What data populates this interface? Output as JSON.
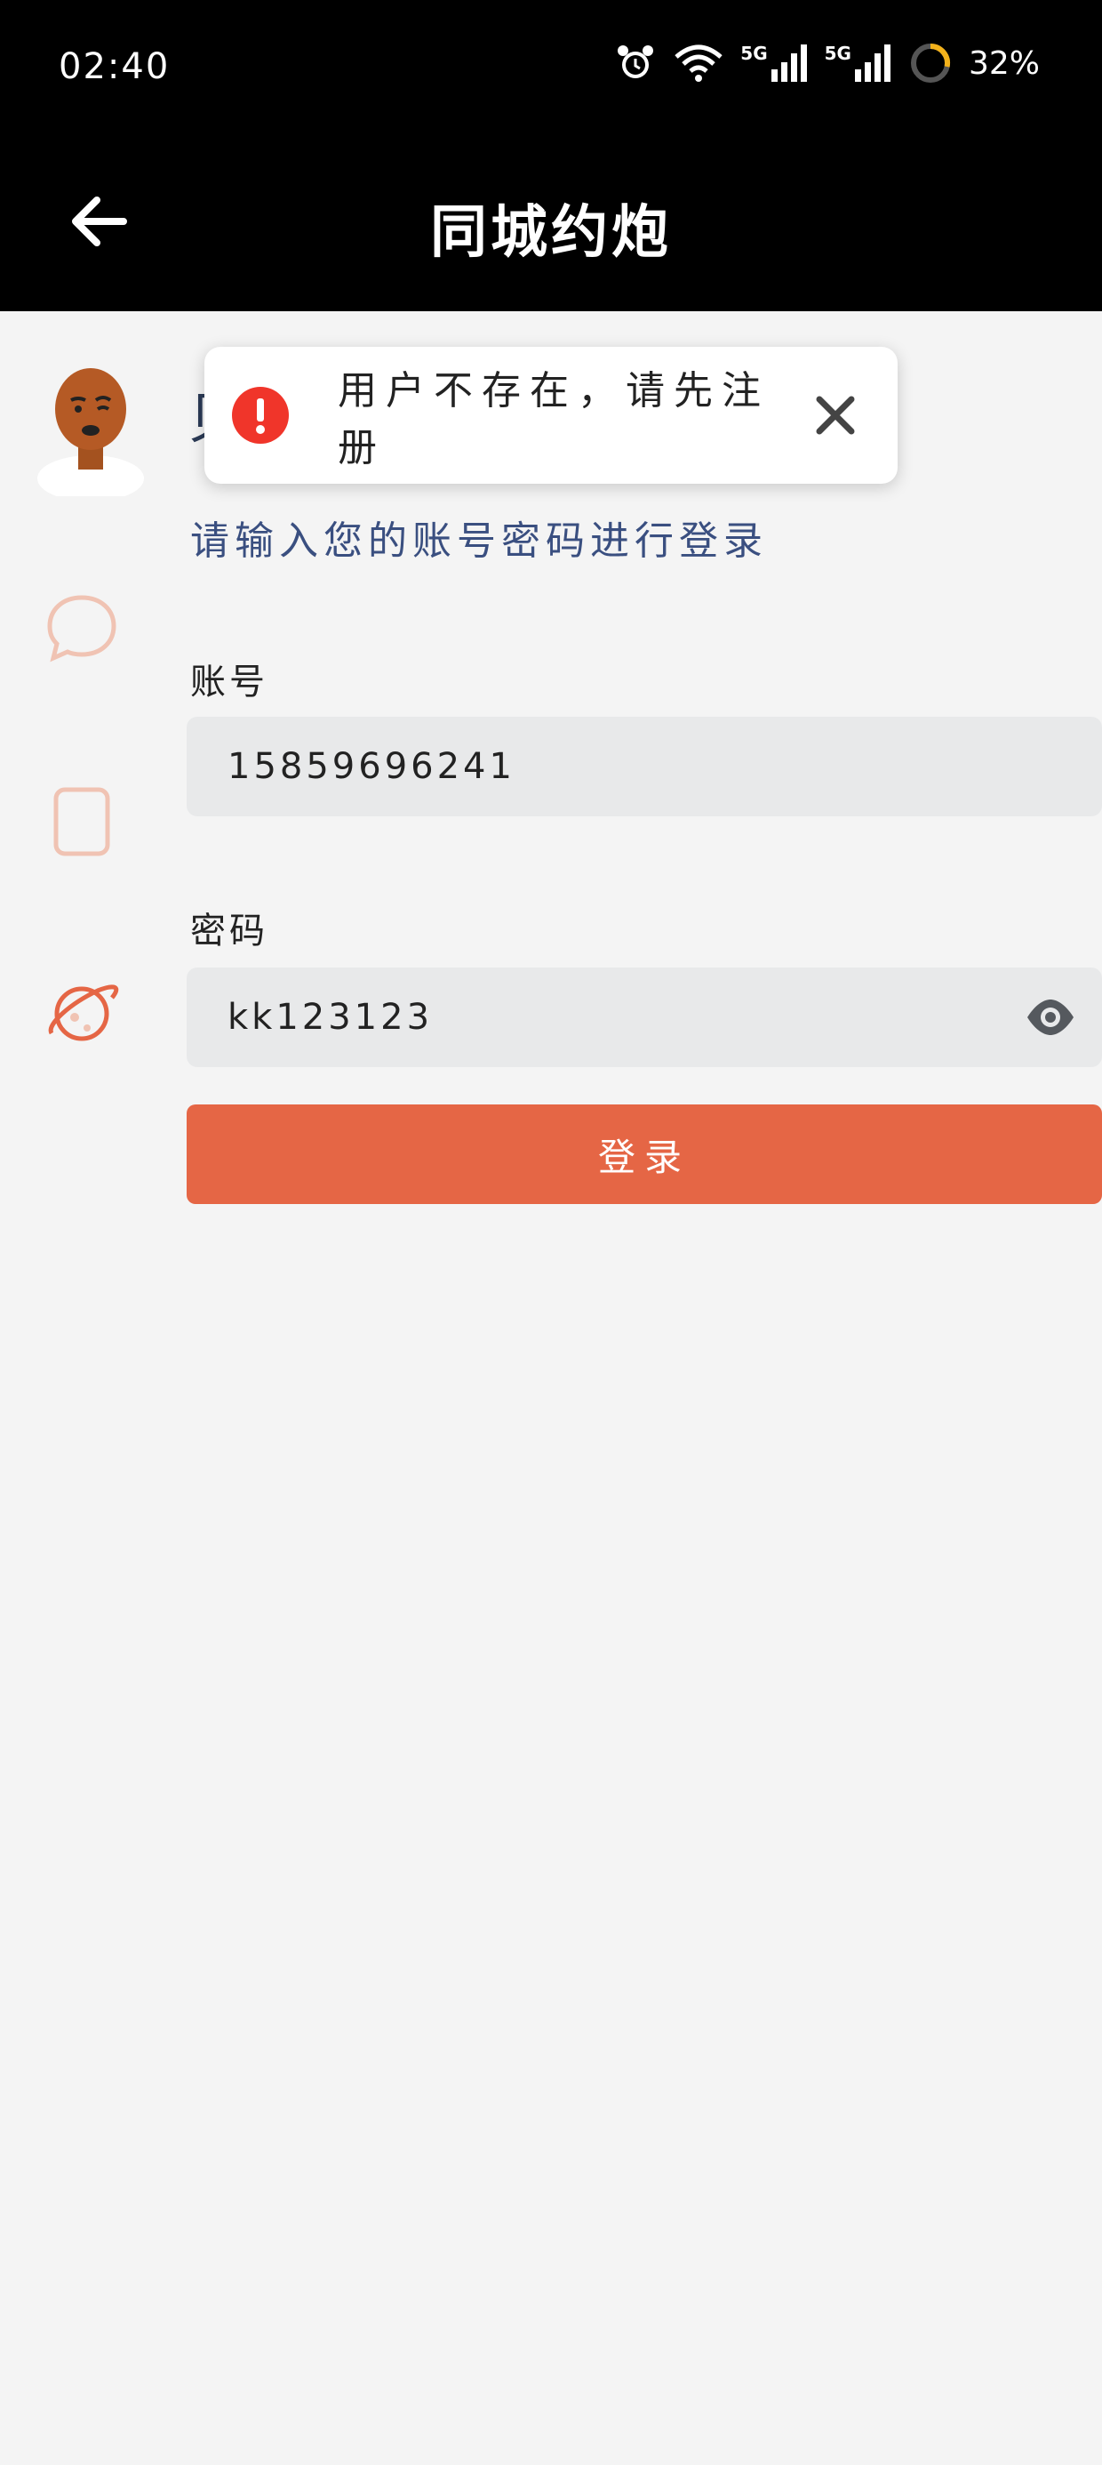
{
  "status_bar": {
    "time": "02:40",
    "battery_percent": "32%",
    "network_label_1": "5G",
    "network_label_2": "5G",
    "icons": [
      "alarm-icon",
      "wifi-icon",
      "signal-5g-icon",
      "signal-5g-icon",
      "battery-ring-icon"
    ]
  },
  "app_bar": {
    "title": "同城约炮",
    "back_icon": "arrow-left-icon"
  },
  "sidebar": {
    "avatar": "avatar-illustration",
    "icons": [
      "chat-bubble-icon",
      "phone-outline-icon",
      "planet-icon"
    ]
  },
  "login": {
    "heading_partial": "贝",
    "subtitle": "请输入您的账号密码进行登录",
    "account_label": "账号",
    "account_value": "15859696241",
    "password_label": "密码",
    "password_value": "kk123123",
    "login_button": "登录"
  },
  "toast": {
    "message": "用户不存在，请先注册",
    "icon": "error-icon",
    "close_icon": "close-icon"
  },
  "colors": {
    "accent": "#e56645",
    "toast_error": "#f0352a",
    "subtitle": "#3a4f80",
    "field_bg": "#e8e9ea",
    "page_bg": "#f4f4f4"
  }
}
